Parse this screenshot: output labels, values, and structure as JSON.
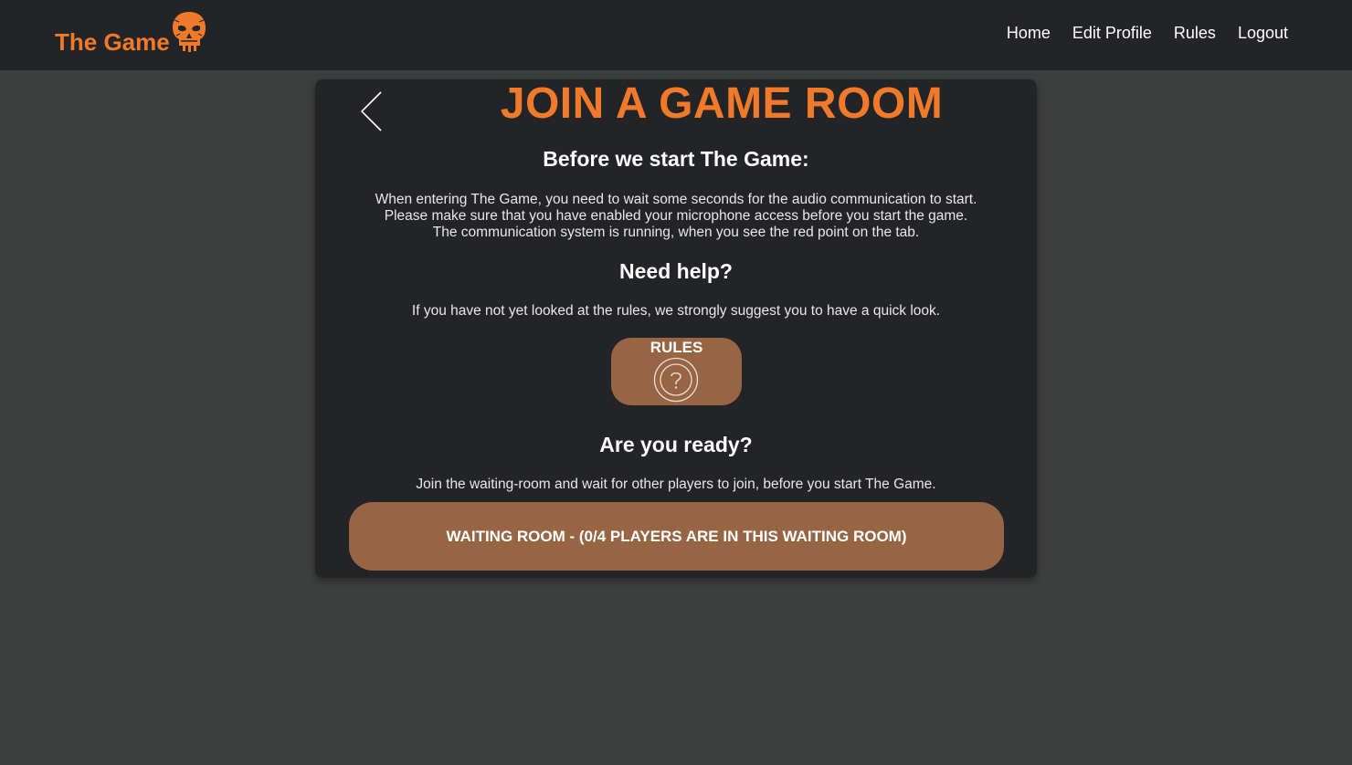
{
  "brand": {
    "name": "The Game",
    "logo_icon": "skull-icon",
    "accent_color": "#f07a2a"
  },
  "nav": {
    "items": [
      {
        "label": "Home"
      },
      {
        "label": "Edit Profile"
      },
      {
        "label": "Rules"
      },
      {
        "label": "Logout"
      }
    ]
  },
  "card": {
    "back_icon": "chevron-left-icon",
    "title": "JOIN A GAME ROOM",
    "before": {
      "heading": "Before we start The Game:",
      "lines": [
        "When entering The Game, you need to wait some seconds for the audio communication to start.",
        "Please make sure that you have enabled your microphone access before you start the game.",
        "The communication system is running, when you see the red point on the tab."
      ]
    },
    "help": {
      "heading": "Need help?",
      "text": "If you have not yet looked at the rules, we strongly suggest you to have a quick look.",
      "button_label": "RULES",
      "button_icon": "question-mark-icon"
    },
    "ready": {
      "heading": "Are you ready?",
      "text": "Join the waiting-room and wait for other players to join, before you start The Game.",
      "button_label": "WAITING ROOM - (0/4 PLAYERS ARE IN THIS WAITING ROOM)"
    }
  },
  "colors": {
    "page_bg": "#3d3f3e",
    "panel_bg": "#232428",
    "button_bg": "#976444"
  }
}
